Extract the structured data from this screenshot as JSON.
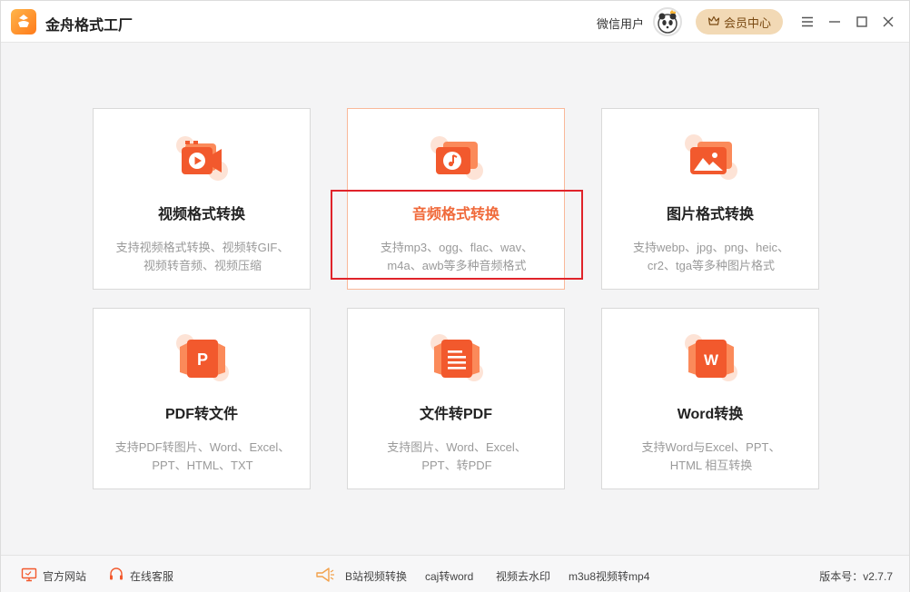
{
  "app": {
    "title": "金舟格式工厂",
    "logo_icon": "app-logo-icon"
  },
  "header": {
    "user_name": "微信用户",
    "vip_label": "会员中心",
    "brand_color": "#f06a3b",
    "vip_bg": "#f2d9b5"
  },
  "cards": [
    {
      "title": "视频格式转换",
      "desc_line1": "支持视频格式转换、视频转GIF、",
      "desc_line2": "视频转音频、视频压缩",
      "icon": "video-icon"
    },
    {
      "title": "音频格式转换",
      "desc_line1": "支持mp3、ogg、flac、wav、",
      "desc_line2": "m4a、awb等多种音频格式",
      "icon": "music-icon",
      "active": true
    },
    {
      "title": "图片格式转换",
      "desc_line1": "支持webp、jpg、png、heic、",
      "desc_line2": "cr2、tga等多种图片格式",
      "icon": "image-icon"
    },
    {
      "title": "PDF转文件",
      "desc_line1": "支持PDF转图片、Word、Excel、",
      "desc_line2": "PPT、HTML、TXT",
      "icon": "pdf-icon",
      "icon_letter": "P"
    },
    {
      "title": "文件转PDF",
      "desc_line1": "支持图片、Word、Excel、",
      "desc_line2": "PPT、转PDF",
      "icon": "document-icon"
    },
    {
      "title": "Word转换",
      "desc_line1": "支持Word与Excel、PPT、",
      "desc_line2": "HTML 相互转换",
      "icon": "word-icon",
      "icon_letter": "W"
    }
  ],
  "footer": {
    "website": "官方网站",
    "support": "在线客服",
    "links": [
      "B站视频转换",
      "caj转word",
      "视频去水印",
      "m3u8视频转mp4"
    ],
    "version": "版本号：v2.7.7"
  }
}
